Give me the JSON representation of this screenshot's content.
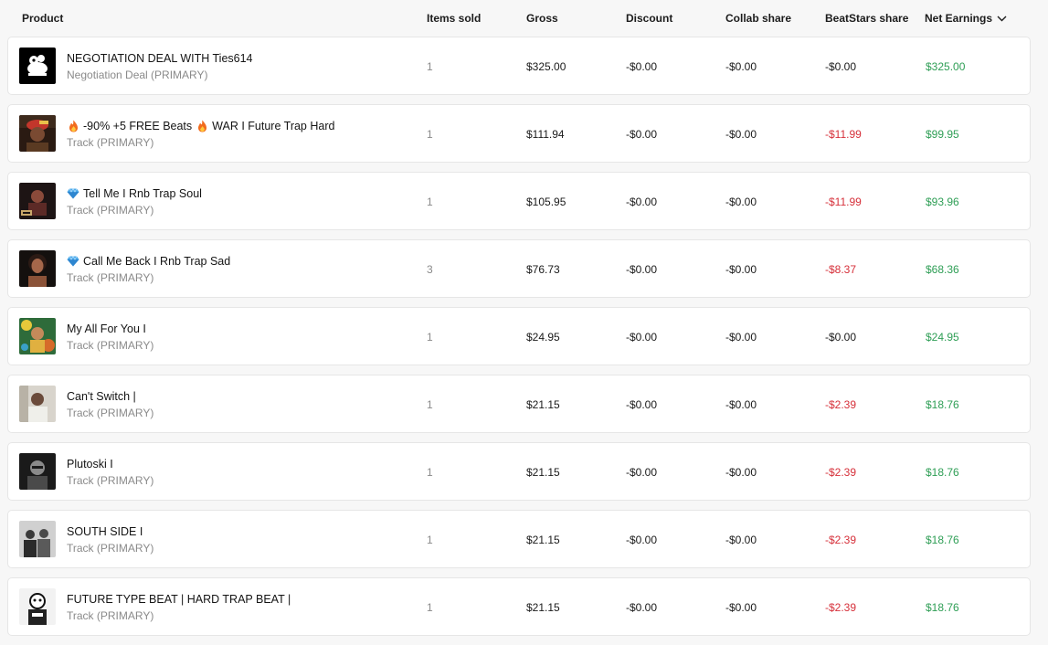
{
  "header": {
    "product": "Product",
    "items_sold": "Items sold",
    "gross": "Gross",
    "discount": "Discount",
    "collab_share": "Collab share",
    "beatstars_share": "BeatStars share",
    "net_earnings": "Net Earnings"
  },
  "colors": {
    "negative": "#d6303a",
    "positive": "#2e9e55",
    "muted": "#8a8a8a"
  },
  "rows": [
    {
      "thumb": "white-cartoon-logo-on-black",
      "title_prefix_icons": [],
      "title_mid_icon": "",
      "title": "NEGOTIATION DEAL WITH Ties614",
      "title_rest": "",
      "subtitle": "Negotiation Deal (PRIMARY)",
      "items": "1",
      "gross": "$325.00",
      "discount": "-$0.00",
      "collab": "-$0.00",
      "bs": "-$0.00",
      "bs_tone": "neutral",
      "net": "$325.00"
    },
    {
      "thumb": "red-cap-portrait",
      "title_prefix_icons": [
        "fire-icon"
      ],
      "title_mid_icon": "fire-icon",
      "title": "-90% +5 FREE Beats",
      "title_rest": "WAR I Future Trap Hard",
      "subtitle": "Track (PRIMARY)",
      "items": "1",
      "gross": "$111.94",
      "discount": "-$0.00",
      "collab": "-$0.00",
      "bs": "-$11.99",
      "bs_tone": "neg",
      "net": "$99.95"
    },
    {
      "thumb": "dark-album-art",
      "title_prefix_icons": [
        "gem-icon"
      ],
      "title_mid_icon": "",
      "title": "Tell Me I Rnb Trap Soul",
      "title_rest": "",
      "subtitle": "Track (PRIMARY)",
      "items": "1",
      "gross": "$105.95",
      "discount": "-$0.00",
      "collab": "-$0.00",
      "bs": "-$11.99",
      "bs_tone": "neg",
      "net": "$93.96"
    },
    {
      "thumb": "woman-portrait",
      "title_prefix_icons": [
        "gem-icon"
      ],
      "title_mid_icon": "",
      "title": "Call Me Back I Rnb Trap Sad",
      "title_rest": "",
      "subtitle": "Track (PRIMARY)",
      "items": "3",
      "gross": "$76.73",
      "discount": "-$0.00",
      "collab": "-$0.00",
      "bs": "-$8.37",
      "bs_tone": "neg",
      "net": "$68.36"
    },
    {
      "thumb": "colorful-floral-portrait",
      "title_prefix_icons": [],
      "title_mid_icon": "",
      "title": "My All For You I",
      "title_rest": "",
      "subtitle": "Track (PRIMARY)",
      "items": "1",
      "gross": "$24.95",
      "discount": "-$0.00",
      "collab": "-$0.00",
      "bs": "-$0.00",
      "bs_tone": "neutral",
      "net": "$24.95"
    },
    {
      "thumb": "light-portrait",
      "title_prefix_icons": [],
      "title_mid_icon": "",
      "title": "Can't Switch |",
      "title_rest": "",
      "subtitle": "Track (PRIMARY)",
      "items": "1",
      "gross": "$21.15",
      "discount": "-$0.00",
      "collab": "-$0.00",
      "bs": "-$2.39",
      "bs_tone": "neg",
      "net": "$18.76"
    },
    {
      "thumb": "bw-portrait",
      "title_prefix_icons": [],
      "title_mid_icon": "",
      "title": "Plutoski I",
      "title_rest": "",
      "subtitle": "Track (PRIMARY)",
      "items": "1",
      "gross": "$21.15",
      "discount": "-$0.00",
      "collab": "-$0.00",
      "bs": "-$2.39",
      "bs_tone": "neg",
      "net": "$18.76"
    },
    {
      "thumb": "bw-group-photo",
      "title_prefix_icons": [],
      "title_mid_icon": "",
      "title": "SOUTH SIDE I",
      "title_rest": "",
      "subtitle": "Track (PRIMARY)",
      "items": "1",
      "gross": "$21.15",
      "discount": "-$0.00",
      "collab": "-$0.00",
      "bs": "-$2.39",
      "bs_tone": "neg",
      "net": "$18.76"
    },
    {
      "thumb": "bw-cartoon-art",
      "title_prefix_icons": [],
      "title_mid_icon": "",
      "title": "FUTURE TYPE BEAT | HARD TRAP BEAT |",
      "title_rest": "",
      "subtitle": "Track (PRIMARY)",
      "items": "1",
      "gross": "$21.15",
      "discount": "-$0.00",
      "collab": "-$0.00",
      "bs": "-$2.39",
      "bs_tone": "neg",
      "net": "$18.76"
    }
  ]
}
